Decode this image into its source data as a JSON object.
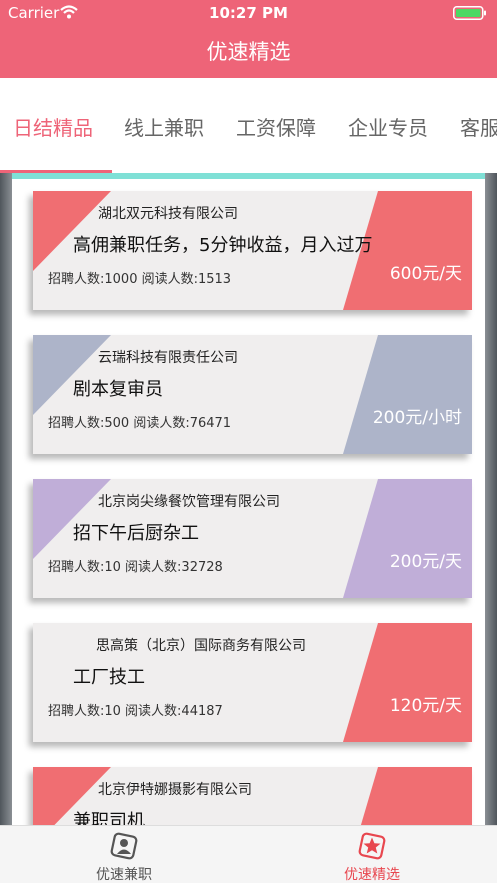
{
  "status": {
    "carrier": "Carrier",
    "time": "10:27 PM"
  },
  "nav": {
    "title": "优速精选"
  },
  "tabs": [
    {
      "label": "日结精品",
      "active": true
    },
    {
      "label": "线上兼职",
      "active": false
    },
    {
      "label": "工资保障",
      "active": false
    },
    {
      "label": "企业专员",
      "active": false
    },
    {
      "label": "客服",
      "active": false
    }
  ],
  "jobs": [
    {
      "company": "湖北双元科技有限公司",
      "title": "高佣兼职任务，5分钟收益，月入过万",
      "counts": "招聘人数:1000  阅读人数:1513",
      "salary": "600元/天",
      "accent": "#f06e72"
    },
    {
      "company": "云瑞科技有限责任公司",
      "title": "剧本复审员",
      "counts": "招聘人数:500  阅读人数:76471",
      "salary": "200元/小时",
      "accent": "#adb4c9"
    },
    {
      "company": "北京岗尖缘餐饮管理有限公司",
      "title": "招下午后厨杂工",
      "counts": "招聘人数:10  阅读人数:32728",
      "salary": "200元/天",
      "accent": "#c0aed8"
    },
    {
      "company": "思高策（北京）国际商务有限公司",
      "title": "工厂技工",
      "counts": "招聘人数:10  阅读人数:44187",
      "salary": "120元/天",
      "accent": "#f06e72"
    },
    {
      "company": "北京伊特娜摄影有限公司",
      "title": "兼职司机",
      "counts": "",
      "salary": "",
      "accent": "#f06e72"
    }
  ],
  "tabbar": [
    {
      "label": "优速兼职",
      "icon": "person-icon",
      "active": false
    },
    {
      "label": "优速精选",
      "icon": "star-icon",
      "active": true
    }
  ]
}
